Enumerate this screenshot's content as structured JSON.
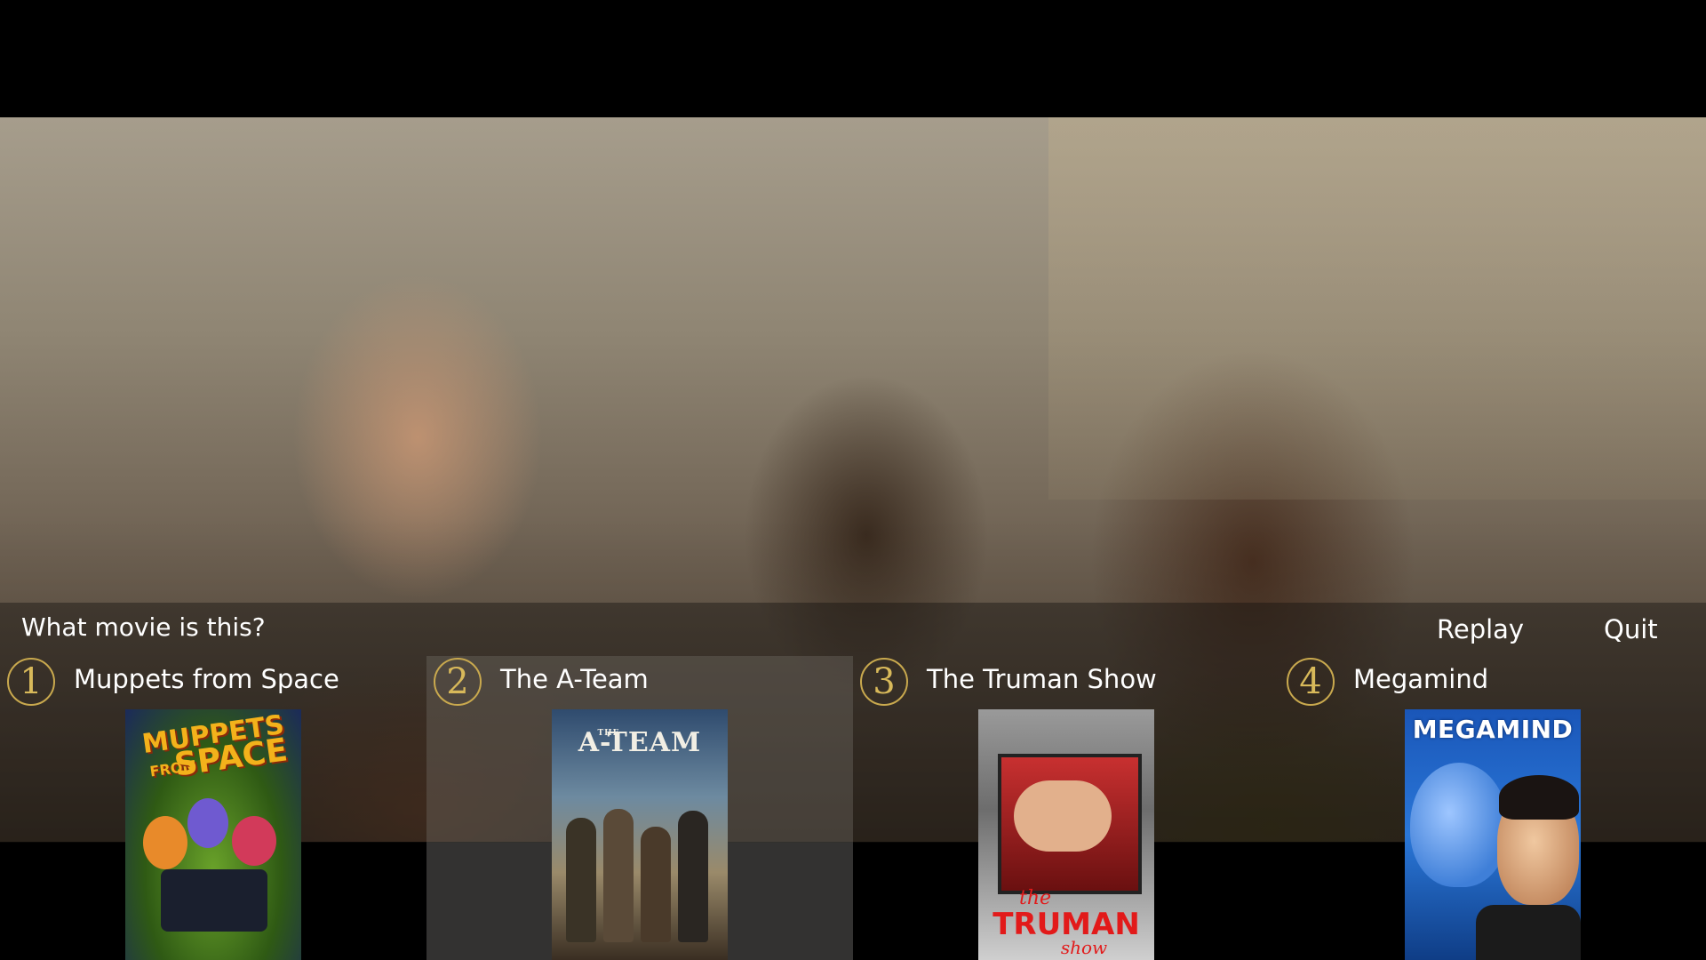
{
  "quiz": {
    "question": "What movie is this?",
    "actions": {
      "replay_label": "Replay",
      "quit_label": "Quit"
    },
    "selected_choice": 2,
    "accent_color": "#c9a94e",
    "choices": [
      {
        "number": "1",
        "title": "Muppets from Space",
        "poster": {
          "title_line1": "MUPPETS",
          "title_line2": "FROM",
          "title_line3": "SPACE"
        }
      },
      {
        "number": "2",
        "title": "The A-Team",
        "poster": {
          "title_line1": "A-TEAM",
          "prefix": "THE"
        }
      },
      {
        "number": "3",
        "title": "The Truman Show",
        "poster": {
          "title_line1": "the",
          "title_line2": "TRUMAN",
          "title_line3": "show"
        }
      },
      {
        "number": "4",
        "title": "Megamind",
        "poster": {
          "title_line1": "MEGAMIND"
        }
      }
    ]
  }
}
